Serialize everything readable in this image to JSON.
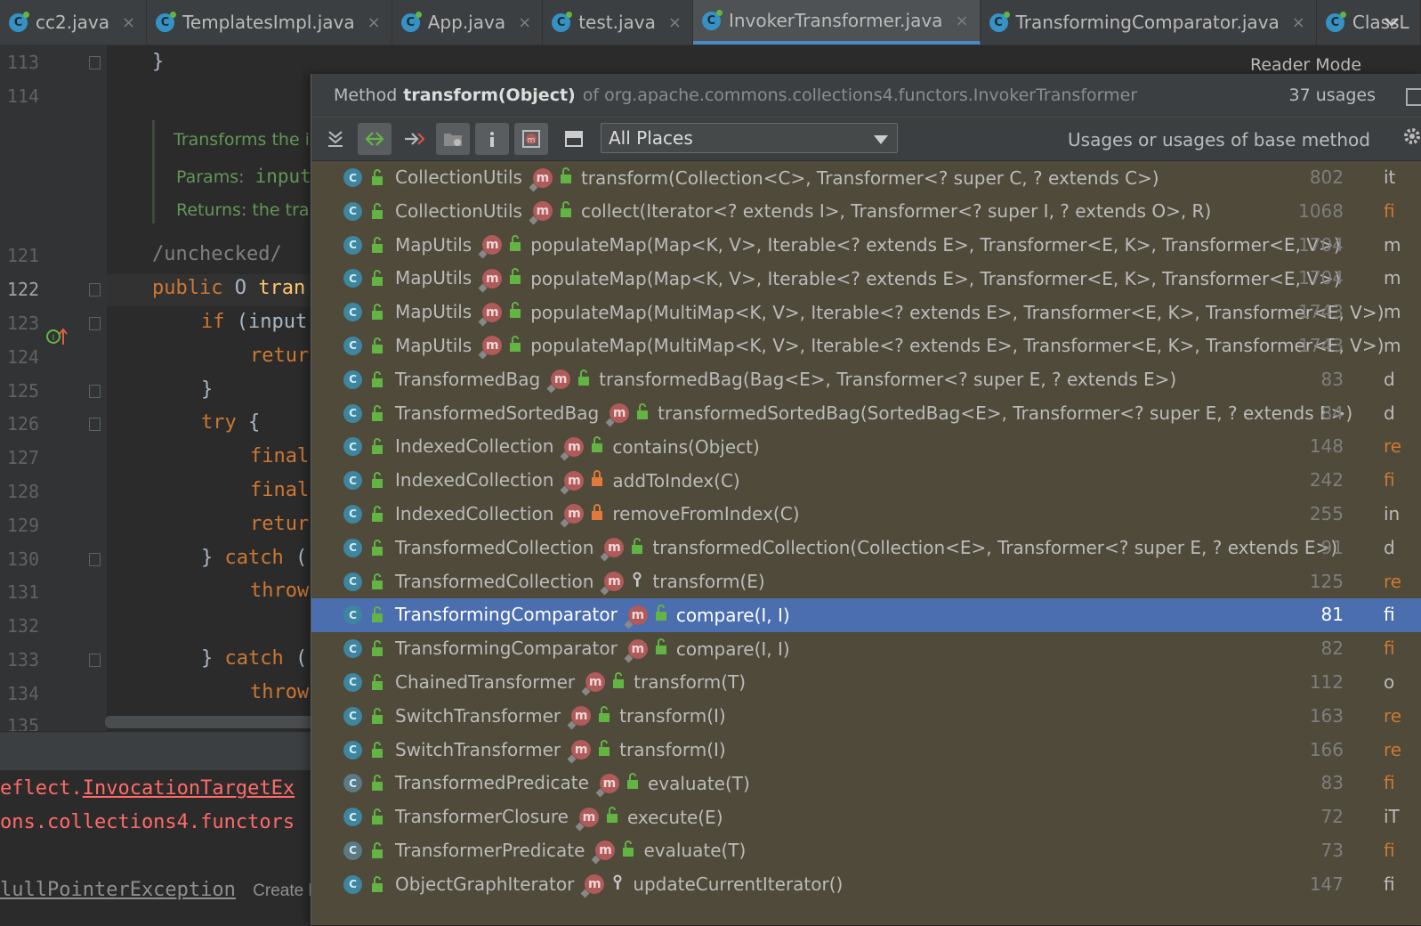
{
  "tabs": [
    {
      "label": "cc2.java",
      "active": false
    },
    {
      "label": "TemplatesImpl.java",
      "active": false
    },
    {
      "label": "App.java",
      "active": false
    },
    {
      "label": "test.java",
      "active": false
    },
    {
      "label": "InvokerTransformer.java",
      "active": true
    },
    {
      "label": "TransformingComparator.java",
      "active": false
    },
    {
      "label": "ClassL",
      "active": false
    }
  ],
  "tab_close_glyph": "×",
  "tab_icon_letter": "C",
  "reader_mode": "Reader Mode",
  "editor": {
    "line_numbers": [
      "113",
      "114",
      "121",
      "122",
      "123",
      "124",
      "125",
      "126",
      "127",
      "128",
      "129",
      "130",
      "131",
      "132",
      "133",
      "134",
      "135"
    ],
    "code": {
      "l113": "}",
      "l121": "/unchecked/",
      "l122_kw": "public",
      "l122_rest": " O ",
      "l122_name": "tran",
      "l123_kw": "if",
      "l123_rest": " (input",
      "l124": "retur",
      "l125": "}",
      "l126_kw": "try",
      "l126_rest": " {",
      "l127": "final",
      "l128": "final",
      "l129": "retur",
      "l130_a": "} ",
      "l130_kw": "catch",
      "l130_b": " (",
      "l131": "throw",
      "l133_a": "} ",
      "l133_kw": "catch",
      "l133_b": " (",
      "l134": "throw"
    },
    "doc": {
      "line1": "Transforms the i",
      "params_label": "Params:",
      "params_val": "input",
      "returns_label": "Returns:",
      "returns_val": "the tra"
    }
  },
  "console": {
    "line1": "eflect.InvocationTargetEx",
    "line1_underlined": "InvocationTargetEx",
    "line2": "ons.collections4.functors",
    "line3": "lullPointerException",
    "create_btn": "Create b"
  },
  "popup": {
    "header_prefix": "Method",
    "method": "transform(Object)",
    "of_class": "of org.apache.commons.collections4.functors.InvokerTransformer",
    "usages_count": "37 usages",
    "scope": "All Places",
    "filter_label": "Usages or usages of base method",
    "rows": [
      {
        "cls": "CollectionUtils",
        "method": "transform(Collection<C>, Transformer<? super C, ? extends C>)",
        "line": "802",
        "trail": "it",
        "access": "public",
        "trail_color": "gray"
      },
      {
        "cls": "CollectionUtils",
        "method": "collect(Iterator<? extends I>, Transformer<? super I, ? extends O>, R)",
        "line": "1068",
        "trail": "fi",
        "access": "public",
        "trail_color": "orange"
      },
      {
        "cls": "MapUtils",
        "method": "populateMap(Map<K, V>, Iterable<? extends E>, Transformer<E, K>, Transformer<E, V>)",
        "line": "1704",
        "trail": "m",
        "access": "public",
        "trail_color": "gray"
      },
      {
        "cls": "MapUtils",
        "method": "populateMap(Map<K, V>, Iterable<? extends E>, Transformer<E, K>, Transformer<E, V>)",
        "line": "1704",
        "trail": "m",
        "access": "public",
        "trail_color": "gray"
      },
      {
        "cls": "MapUtils",
        "method": "populateMap(MultiMap<K, V>, Iterable<? extends E>, Transformer<E, K>, Transformer<E, V>)",
        "line": "1743",
        "trail": "m",
        "access": "public",
        "trail_color": "gray"
      },
      {
        "cls": "MapUtils",
        "method": "populateMap(MultiMap<K, V>, Iterable<? extends E>, Transformer<E, K>, Transformer<E, V>)",
        "line": "1743",
        "trail": "m",
        "access": "public",
        "trail_color": "gray"
      },
      {
        "cls": "TransformedBag",
        "method": "transformedBag(Bag<E>, Transformer<? super E, ? extends E>)",
        "line": "83",
        "trail": "d",
        "access": "public",
        "trail_color": "gray"
      },
      {
        "cls": "TransformedSortedBag",
        "method": "transformedSortedBag(SortedBag<E>, Transformer<? super E, ? extends E>)",
        "line": "84",
        "trail": "d",
        "access": "public",
        "trail_color": "gray"
      },
      {
        "cls": "IndexedCollection",
        "method": "contains(Object)",
        "line": "148",
        "trail": "re",
        "access": "public",
        "trail_color": "orange"
      },
      {
        "cls": "IndexedCollection",
        "method": "addToIndex(C)",
        "line": "242",
        "trail": "fi",
        "access": "private",
        "trail_color": "orange"
      },
      {
        "cls": "IndexedCollection",
        "method": "removeFromIndex(C)",
        "line": "255",
        "trail": "in",
        "access": "private",
        "trail_color": "gray"
      },
      {
        "cls": "TransformedCollection",
        "method": "transformedCollection(Collection<E>, Transformer<? super E, ? extends E>)",
        "line": "91",
        "trail": "d",
        "access": "public",
        "trail_color": "gray"
      },
      {
        "cls": "TransformedCollection",
        "method": "transform(E)",
        "line": "125",
        "trail": "re",
        "access": "protected",
        "trail_color": "orange"
      },
      {
        "cls": "TransformingComparator",
        "method": "compare(I, I)",
        "line": "81",
        "trail": "fi",
        "access": "public",
        "trail_color": "orange",
        "selected": true
      },
      {
        "cls": "TransformingComparator",
        "method": "compare(I, I)",
        "line": "82",
        "trail": "fi",
        "access": "public",
        "trail_color": "orange"
      },
      {
        "cls": "ChainedTransformer",
        "method": "transform(T)",
        "line": "112",
        "trail": "o",
        "access": "public",
        "trail_color": "gray"
      },
      {
        "cls": "SwitchTransformer",
        "method": "transform(I)",
        "line": "163",
        "trail": "re",
        "access": "public",
        "trail_color": "orange"
      },
      {
        "cls": "SwitchTransformer",
        "method": "transform(I)",
        "line": "166",
        "trail": "re",
        "access": "public",
        "trail_color": "orange"
      },
      {
        "cls": "TransformedPredicate",
        "method": "evaluate(T)",
        "line": "83",
        "trail": "fi",
        "access": "public",
        "trail_color": "orange",
        "abstract_icon": true
      },
      {
        "cls": "TransformerClosure",
        "method": "execute(E)",
        "line": "72",
        "trail": "iT",
        "access": "public",
        "trail_color": "gray"
      },
      {
        "cls": "TransformerPredicate",
        "method": "evaluate(T)",
        "line": "73",
        "trail": "fi",
        "access": "public",
        "trail_color": "orange",
        "abstract_icon": true
      },
      {
        "cls": "ObjectGraphIterator",
        "method": "updateCurrentIterator()",
        "line": "147",
        "trail": "fi",
        "access": "protected",
        "trail_color": "gray"
      }
    ]
  },
  "colors": {
    "selection": "#4b6eaf",
    "popup_bg": "#4f4a3a",
    "keyword": "#cc7832",
    "doc_comment": "#629755"
  }
}
